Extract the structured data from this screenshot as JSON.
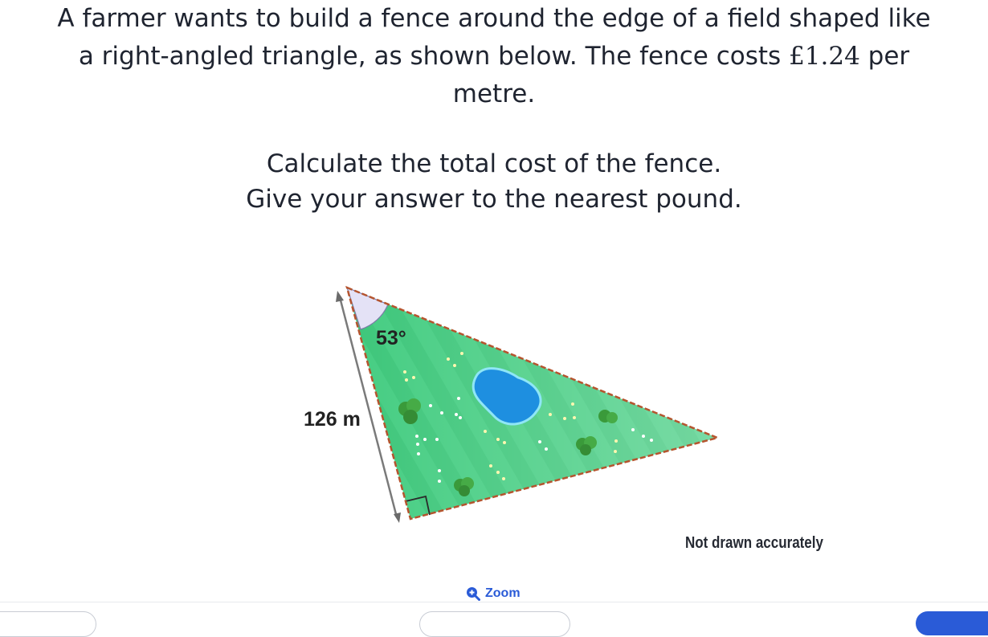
{
  "question": {
    "line1": "A farmer wants to build a fence around the edge of a field shaped like",
    "line2_before": "a right-angled triangle, as shown below. The fence costs ",
    "line2_math": "£1.24",
    "line2_after": " per",
    "line3": "metre."
  },
  "instructions": {
    "line1": "Calculate the total cost of the fence.",
    "line2": "Give your answer to the nearest pound."
  },
  "diagram": {
    "angle_label": "53°",
    "side_label": "126 m",
    "note": "Not drawn accurately",
    "colors": {
      "field": "#3dc67a",
      "field_light": "#6fd9a0",
      "fence": "#b5542e",
      "pond": "#1e8fe0",
      "angle_fill": "#e4e2f6",
      "bush": "#3a9a3a"
    }
  },
  "zoom": {
    "label": "Zoom",
    "icon": "zoom-in-icon"
  }
}
